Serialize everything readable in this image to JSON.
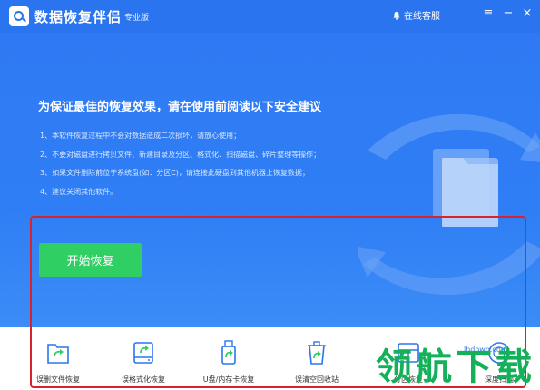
{
  "app": {
    "title": "数据恢复伴侣",
    "edition": "专业版",
    "online_service": "在线客服"
  },
  "main": {
    "headline": "为保证最佳的恢复效果，请在使用前阅读以下安全建议",
    "tips": [
      "1、本软件恢复过程中不会对数据造成二次损坏，请放心使用；",
      "2、不要对磁盘进行拷贝文件、新建目录及分区、格式化、扫描磁盘、碎片整理等操作；",
      "3、如果文件删除前位于系统盘(如：分区C)，请连接此硬盘到其他机器上恢复数据；",
      "4、建议关闭其他软件。"
    ],
    "start_label": "开始恢复"
  },
  "tools": [
    {
      "label": "误删文件恢复",
      "icon": "folder-restore-icon"
    },
    {
      "label": "误格式化恢复",
      "icon": "drive-format-icon"
    },
    {
      "label": "U盘/内存卡恢复",
      "icon": "usb-drive-icon"
    },
    {
      "label": "误清空回收站",
      "icon": "recycle-bin-icon"
    },
    {
      "label": "分区恢复",
      "icon": "partition-icon"
    },
    {
      "label": "深度扫描",
      "icon": "deep-scan-icon"
    }
  ],
  "watermark": {
    "text": "领航下载",
    "url": "lhdown.com"
  },
  "colors": {
    "brand_blue": "#2b74f0",
    "start_green": "#2fcf63",
    "highlight_red": "#d6232f",
    "watermark_green": "#14b05a"
  }
}
